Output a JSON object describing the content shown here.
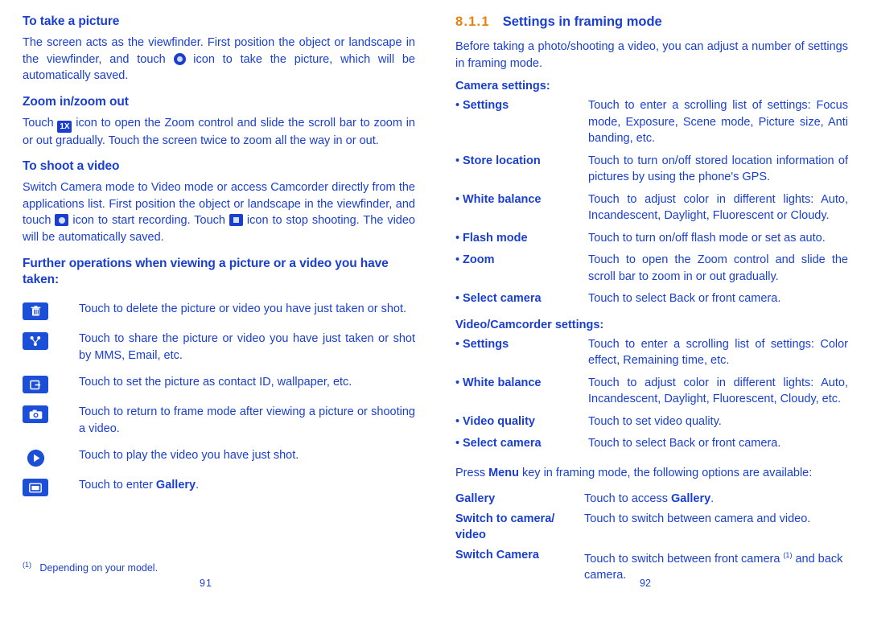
{
  "left": {
    "h1": "To take a picture",
    "p1_before": "The screen acts as the viewfinder. First position the object or landscape in the viewfinder, and touch ",
    "p1_after": " icon to take the picture, which will be automatically saved.",
    "h2": "Zoom in/zoom out",
    "p2_before": "Touch ",
    "p2_icon_text": "1X",
    "p2_after": " icon to open the Zoom control and slide the scroll bar to zoom in or out gradually. Touch the screen twice to zoom all the way in or out.",
    "h3": "To shoot a video",
    "p3_a": "Switch Camera mode to Video mode or access Camcorder directly from the applications list. First position the object or landscape in the viewfinder, and touch ",
    "p3_b": " icon to start recording. Touch ",
    "p3_c": " icon to stop shooting. The video will be automatically saved.",
    "h4": "Further operations when viewing a picture or a video you have taken:",
    "icon_rows": [
      {
        "icon": "trash-icon",
        "text": "Touch to delete the picture or video you have just taken or shot."
      },
      {
        "icon": "share-icon",
        "text": "Touch to share the picture or video you have just taken or shot by MMS, Email, etc."
      },
      {
        "icon": "set-as-icon",
        "text": "Touch to set the picture as contact ID, wallpaper, etc."
      },
      {
        "icon": "camera-icon",
        "text": "Touch to return to frame mode after viewing a picture or shooting a video."
      },
      {
        "icon": "play-icon",
        "text": "Touch to play the video you have just shot."
      },
      {
        "icon": "gallery-icon",
        "text": "Touch to enter Gallery."
      }
    ],
    "footnote": "Depending on your model.",
    "footnote_mark": "(1)",
    "page_number": "91"
  },
  "right": {
    "section_number": "8.1.1",
    "section_title": "Settings in framing mode",
    "intro": "Before taking a photo/shooting a video, you can adjust a number of settings in framing mode.",
    "camera_settings_head": "Camera settings:",
    "camera_settings": [
      {
        "label": "Settings",
        "desc": "Touch to enter a scrolling list of settings: Focus mode, Exposure, Scene mode, Picture size, Anti banding, etc."
      },
      {
        "label": "Store location",
        "desc": "Touch to turn on/off stored location information of pictures by using the phone's GPS."
      },
      {
        "label": "White balance",
        "desc": "Touch to adjust color in different lights: Auto, Incandescent, Daylight, Fluorescent or Cloudy."
      },
      {
        "label": "Flash mode",
        "desc": "Touch to turn on/off flash mode or set as auto."
      },
      {
        "label": "Zoom",
        "desc": "Touch to open the Zoom control and slide the scroll bar to zoom in or out gradually."
      },
      {
        "label": "Select camera",
        "desc": "Touch to select Back or front camera."
      }
    ],
    "video_settings_head": "Video/Camcorder settings:",
    "video_settings": [
      {
        "label": "Settings",
        "desc": "Touch to enter a scrolling list of settings: Color effect, Remaining time, etc."
      },
      {
        "label": "White balance",
        "desc": "Touch to adjust color in different lights: Auto, Incandescent, Daylight, Fluorescent, Cloudy, etc."
      },
      {
        "label": "Video quality",
        "desc": "Touch to set video quality."
      },
      {
        "label": "Select camera",
        "desc": "Touch to select Back or front camera."
      }
    ],
    "menu_intro_a": "Press ",
    "menu_intro_b": "Menu",
    "menu_intro_c": " key in framing mode, the following options are available:",
    "menu_rows": [
      {
        "label": "Gallery",
        "desc_a": "Touch to access ",
        "desc_b": "Gallery",
        "desc_c": "."
      },
      {
        "label": "Switch to camera/ video",
        "desc_a": "Touch to switch between camera and video.",
        "desc_b": "",
        "desc_c": ""
      },
      {
        "label": "Switch Camera",
        "desc_a": "Touch to switch between front camera ",
        "desc_b": "(1)",
        "desc_c": " and back camera."
      }
    ],
    "page_number": "92"
  }
}
